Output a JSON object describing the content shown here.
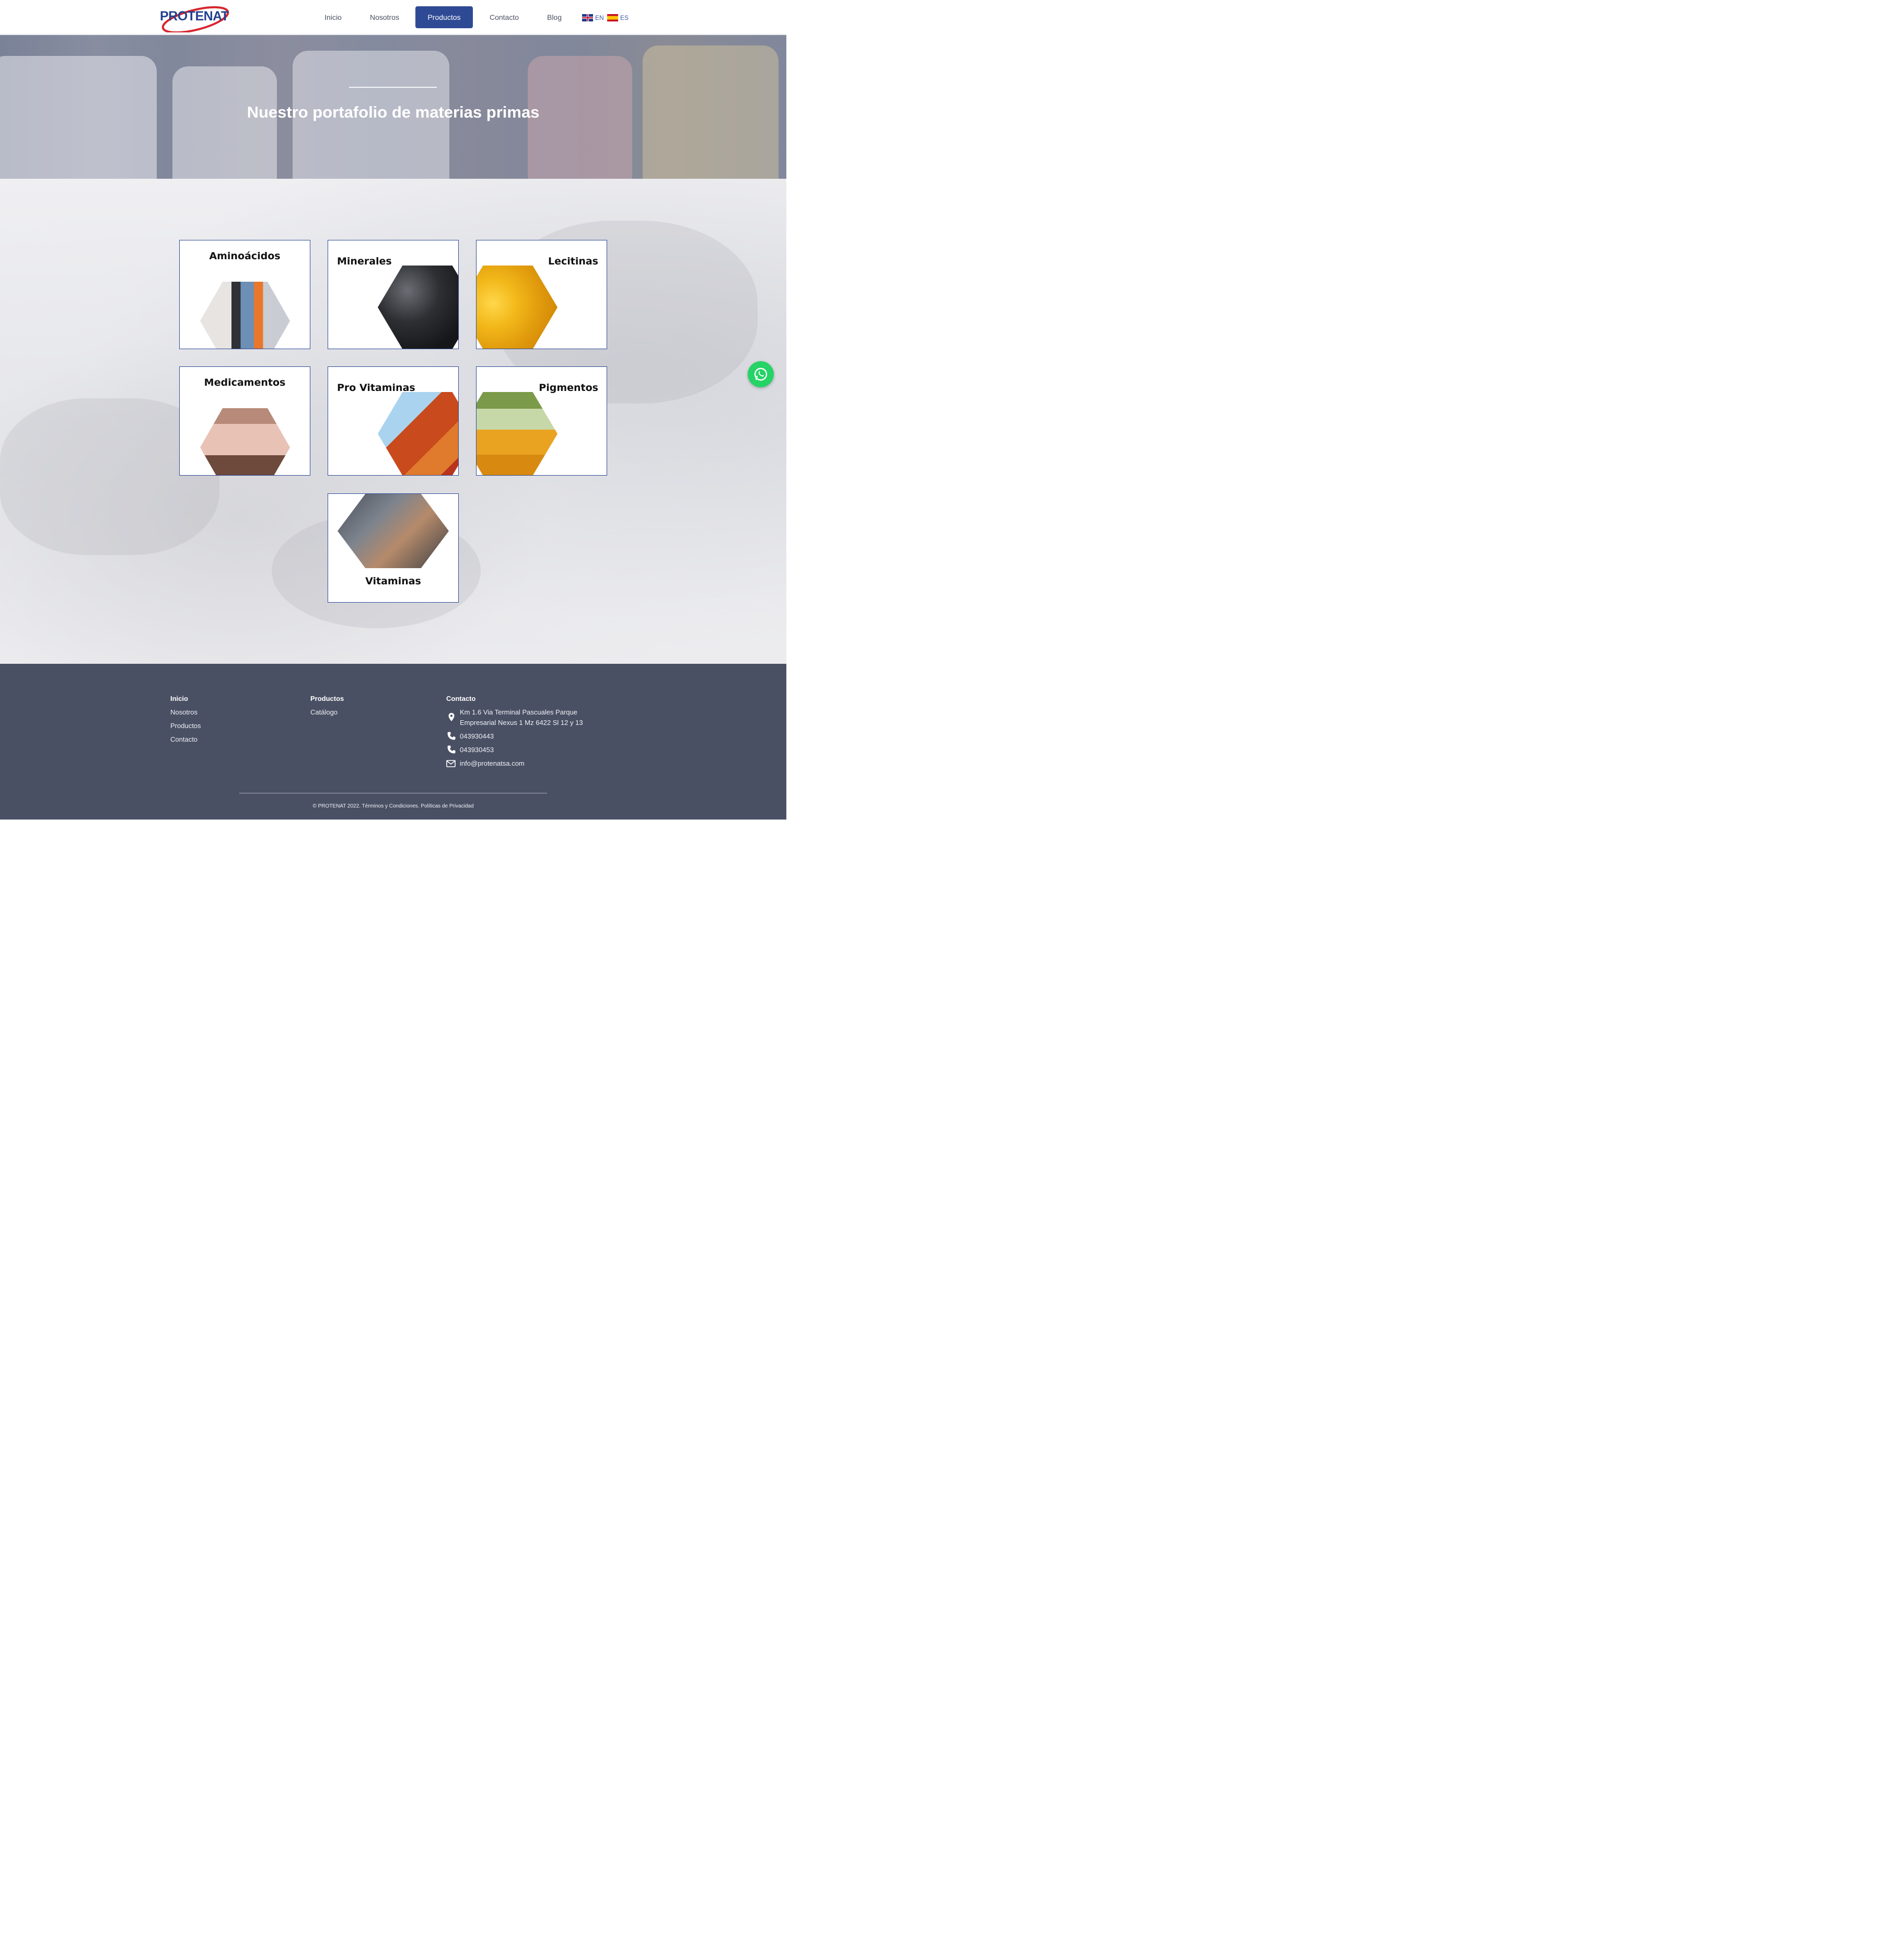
{
  "header": {
    "logo_text": "PROTENAT",
    "nav": [
      {
        "label": "Inicio",
        "active": false
      },
      {
        "label": "Nosotros",
        "active": false
      },
      {
        "label": "Productos",
        "active": true
      },
      {
        "label": "Contacto",
        "active": false
      },
      {
        "label": "Blog",
        "active": false
      }
    ],
    "languages": [
      {
        "code": "EN",
        "flag": "uk-flag-icon"
      },
      {
        "code": "ES",
        "flag": "spain-flag-icon"
      }
    ],
    "accent_color": "#2f4a95"
  },
  "hero": {
    "title": "Nuestro portafolio de materias primas"
  },
  "products": [
    {
      "name": "Aminoácidos",
      "image": "forklift-warehouse-image"
    },
    {
      "name": "Minerales",
      "image": "mineral-rocks-image"
    },
    {
      "name": "Lecitinas",
      "image": "oil-bubbles-image"
    },
    {
      "name": "Medicamentos",
      "image": "pigs-image"
    },
    {
      "name": "Pro Vitaminas",
      "image": "hen-image"
    },
    {
      "name": "Pigmentos",
      "image": "pigment-powders-image"
    },
    {
      "name": "Vitaminas",
      "image": "shrimp-image"
    }
  ],
  "whatsapp": {
    "icon": "whatsapp-icon",
    "color": "#25d366"
  },
  "footer": {
    "col1": {
      "title": "Inicio",
      "links": [
        "Nosotros",
        "Productos",
        "Contacto"
      ]
    },
    "col2": {
      "title": "Productos",
      "links": [
        "Catálogo"
      ]
    },
    "col3": {
      "title": "Contacto",
      "address_line1": "Km 1.6 Via Terminal Pascuales Parque",
      "address_line2": "Empresarial Nexus 1 Mz 6422 Sl 12 y 13",
      "phone1": "043930443",
      "phone2": "043930453",
      "email": "info@protenatsa.com"
    },
    "copyright": "© PROTENAT 2022. Términos y Condiciones. Políticas de Privacidad",
    "background_color": "#4a5064"
  }
}
